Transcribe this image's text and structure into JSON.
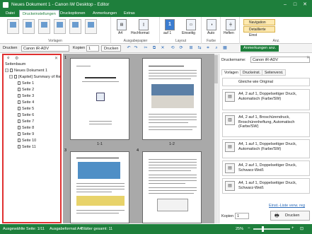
{
  "window": {
    "title": "Neues Dokument 1 - Canon iW Desktop - Editor"
  },
  "menu_tabs": [
    "Datei",
    "Druckeinstellungen",
    "Druckoptionen",
    "Anmerkungen",
    "Extras"
  ],
  "ribbon": {
    "groups": {
      "vorlagen": "Vorlagen",
      "ausgabepapier": "Ausgabepapier",
      "layout": "Layout",
      "farbe": "Farbe",
      "anzeige": "Anz."
    },
    "paper_size": "A4",
    "orientation": "Hochformat",
    "pages_per_sheet": "1",
    "pages_per_sheet_sub": "auf 1",
    "duplex": "Einseitig",
    "color": "Auto",
    "stapling": "Heften",
    "navigation": "Navigation",
    "detail_view": "Detaillierte Einst"
  },
  "printbar": {
    "printer_label": "Drucken",
    "printer": "Canon iR-ADV",
    "copies_label": "Kopien",
    "copies": "1",
    "print_button": "Drucken",
    "annotations_button": "Anmerkungen anz."
  },
  "left_panel": {
    "title": "Seitenbaum",
    "root": "Neues Dokument 1",
    "chapter": "[Kapitel] Summary of Re",
    "pages": [
      "Seite 1",
      "Seite 2",
      "Seite 3",
      "Seite 4",
      "Seite 5",
      "Seite 6",
      "Seite 7",
      "Seite 8",
      "Seite 9",
      "Seite 10",
      "Seite 11"
    ]
  },
  "center": {
    "page_numbers": [
      "1",
      "2",
      "3",
      "4"
    ],
    "sheet_labels": [
      "1-1",
      "1-2"
    ]
  },
  "right_panel": {
    "printer_label": "Druckername:",
    "printer": "Canon iR-ADV",
    "tabs": [
      "Vorlagen",
      "Druckeinst.",
      "Seitenverst."
    ],
    "settings": [
      "Gleiche wie Original",
      "A4, 2 auf 1, Doppelseitiger Druck, Automatisch (Farbe/SW)",
      "A4, 2 auf 1, Broschürendruck, Broschürenheftung, Automatisch (Farbe/SW)",
      "A4, 1 auf 1, Doppelseitiger Druck, Automatisch (Farbe/SW)",
      "A4, 2 auf 1, Doppelseitiger Druck, Schwarz-Weiß",
      "A4, 1 auf 1, Doppelseitiger Druck, Schwarz-Weiß"
    ],
    "link": "Einst.-Liste verw. reg",
    "copies_label": "Kopien",
    "copies": "1",
    "print_button": "Drucken"
  },
  "statusbar": {
    "selected": "Ausgewählte Seite: 1/11",
    "format": "Ausgabeformat:A4",
    "sheets": "Blätter gesamt: 11",
    "zoom": "25%"
  },
  "colors": {
    "accent": "#1e7f3c",
    "highlight": "#e03030"
  }
}
